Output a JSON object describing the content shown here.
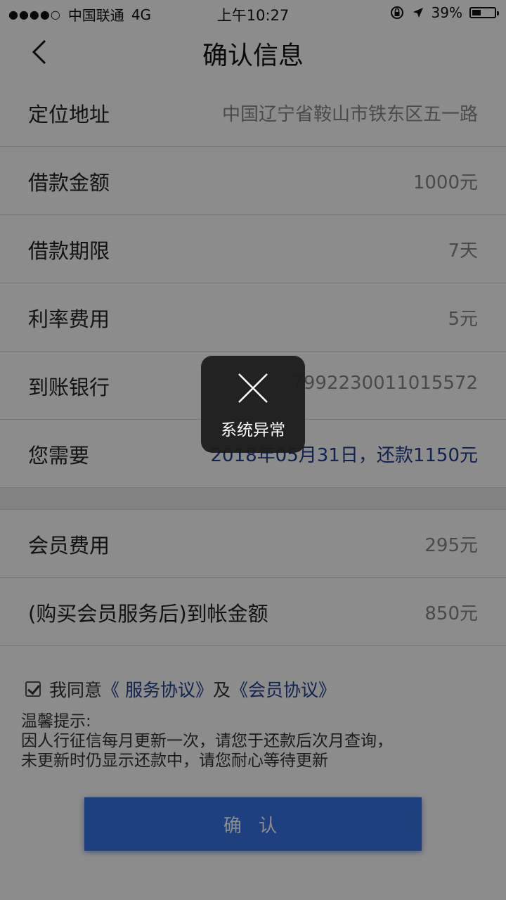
{
  "status_bar": {
    "signal_dots": "●●●●○",
    "carrier": "中国联通",
    "network": "4G",
    "time": "上午10:27",
    "battery_percent": "39%",
    "battery_level": 0.39,
    "icons": [
      "lock-rotation-icon",
      "location-arrow-icon",
      "battery-icon"
    ]
  },
  "nav": {
    "title": "确认信息",
    "back_icon": "chevron-left-icon"
  },
  "rows": [
    {
      "label": "定位地址",
      "value": "中国辽宁省鞍山市铁东区五一路"
    },
    {
      "label": "借款金额",
      "value": "1000元"
    },
    {
      "label": "借款期限",
      "value": "7天"
    },
    {
      "label": "利率费用",
      "value": "5元"
    },
    {
      "label": "到账银行",
      "value": "7992230011015572"
    },
    {
      "label": "您需要",
      "value": "2018年05月31日，还款1150元"
    }
  ],
  "rows2": [
    {
      "label": "会员费用",
      "value": "295元"
    },
    {
      "label": "(购买会员服务后)到帐金额",
      "value": "850元"
    }
  ],
  "agreement": {
    "prefix": "我同意",
    "service_link": "《 服务协议》",
    "and": "及",
    "member_link": "《会员协议》",
    "checked": true
  },
  "tips": {
    "title": "温馨提示:",
    "line1": "因人行征信每月更新一次，请您于还款后次月查询，",
    "line2": "未更新时仍显示还款中，请您耐心等待更新"
  },
  "confirm_button": "确 认",
  "toast": {
    "icon": "close-icon",
    "message": "系统异常"
  },
  "colors": {
    "primary_button": "#3a76e8",
    "link": "#1f3f8f",
    "overlay": "rgba(0,0,0,0.45)"
  }
}
